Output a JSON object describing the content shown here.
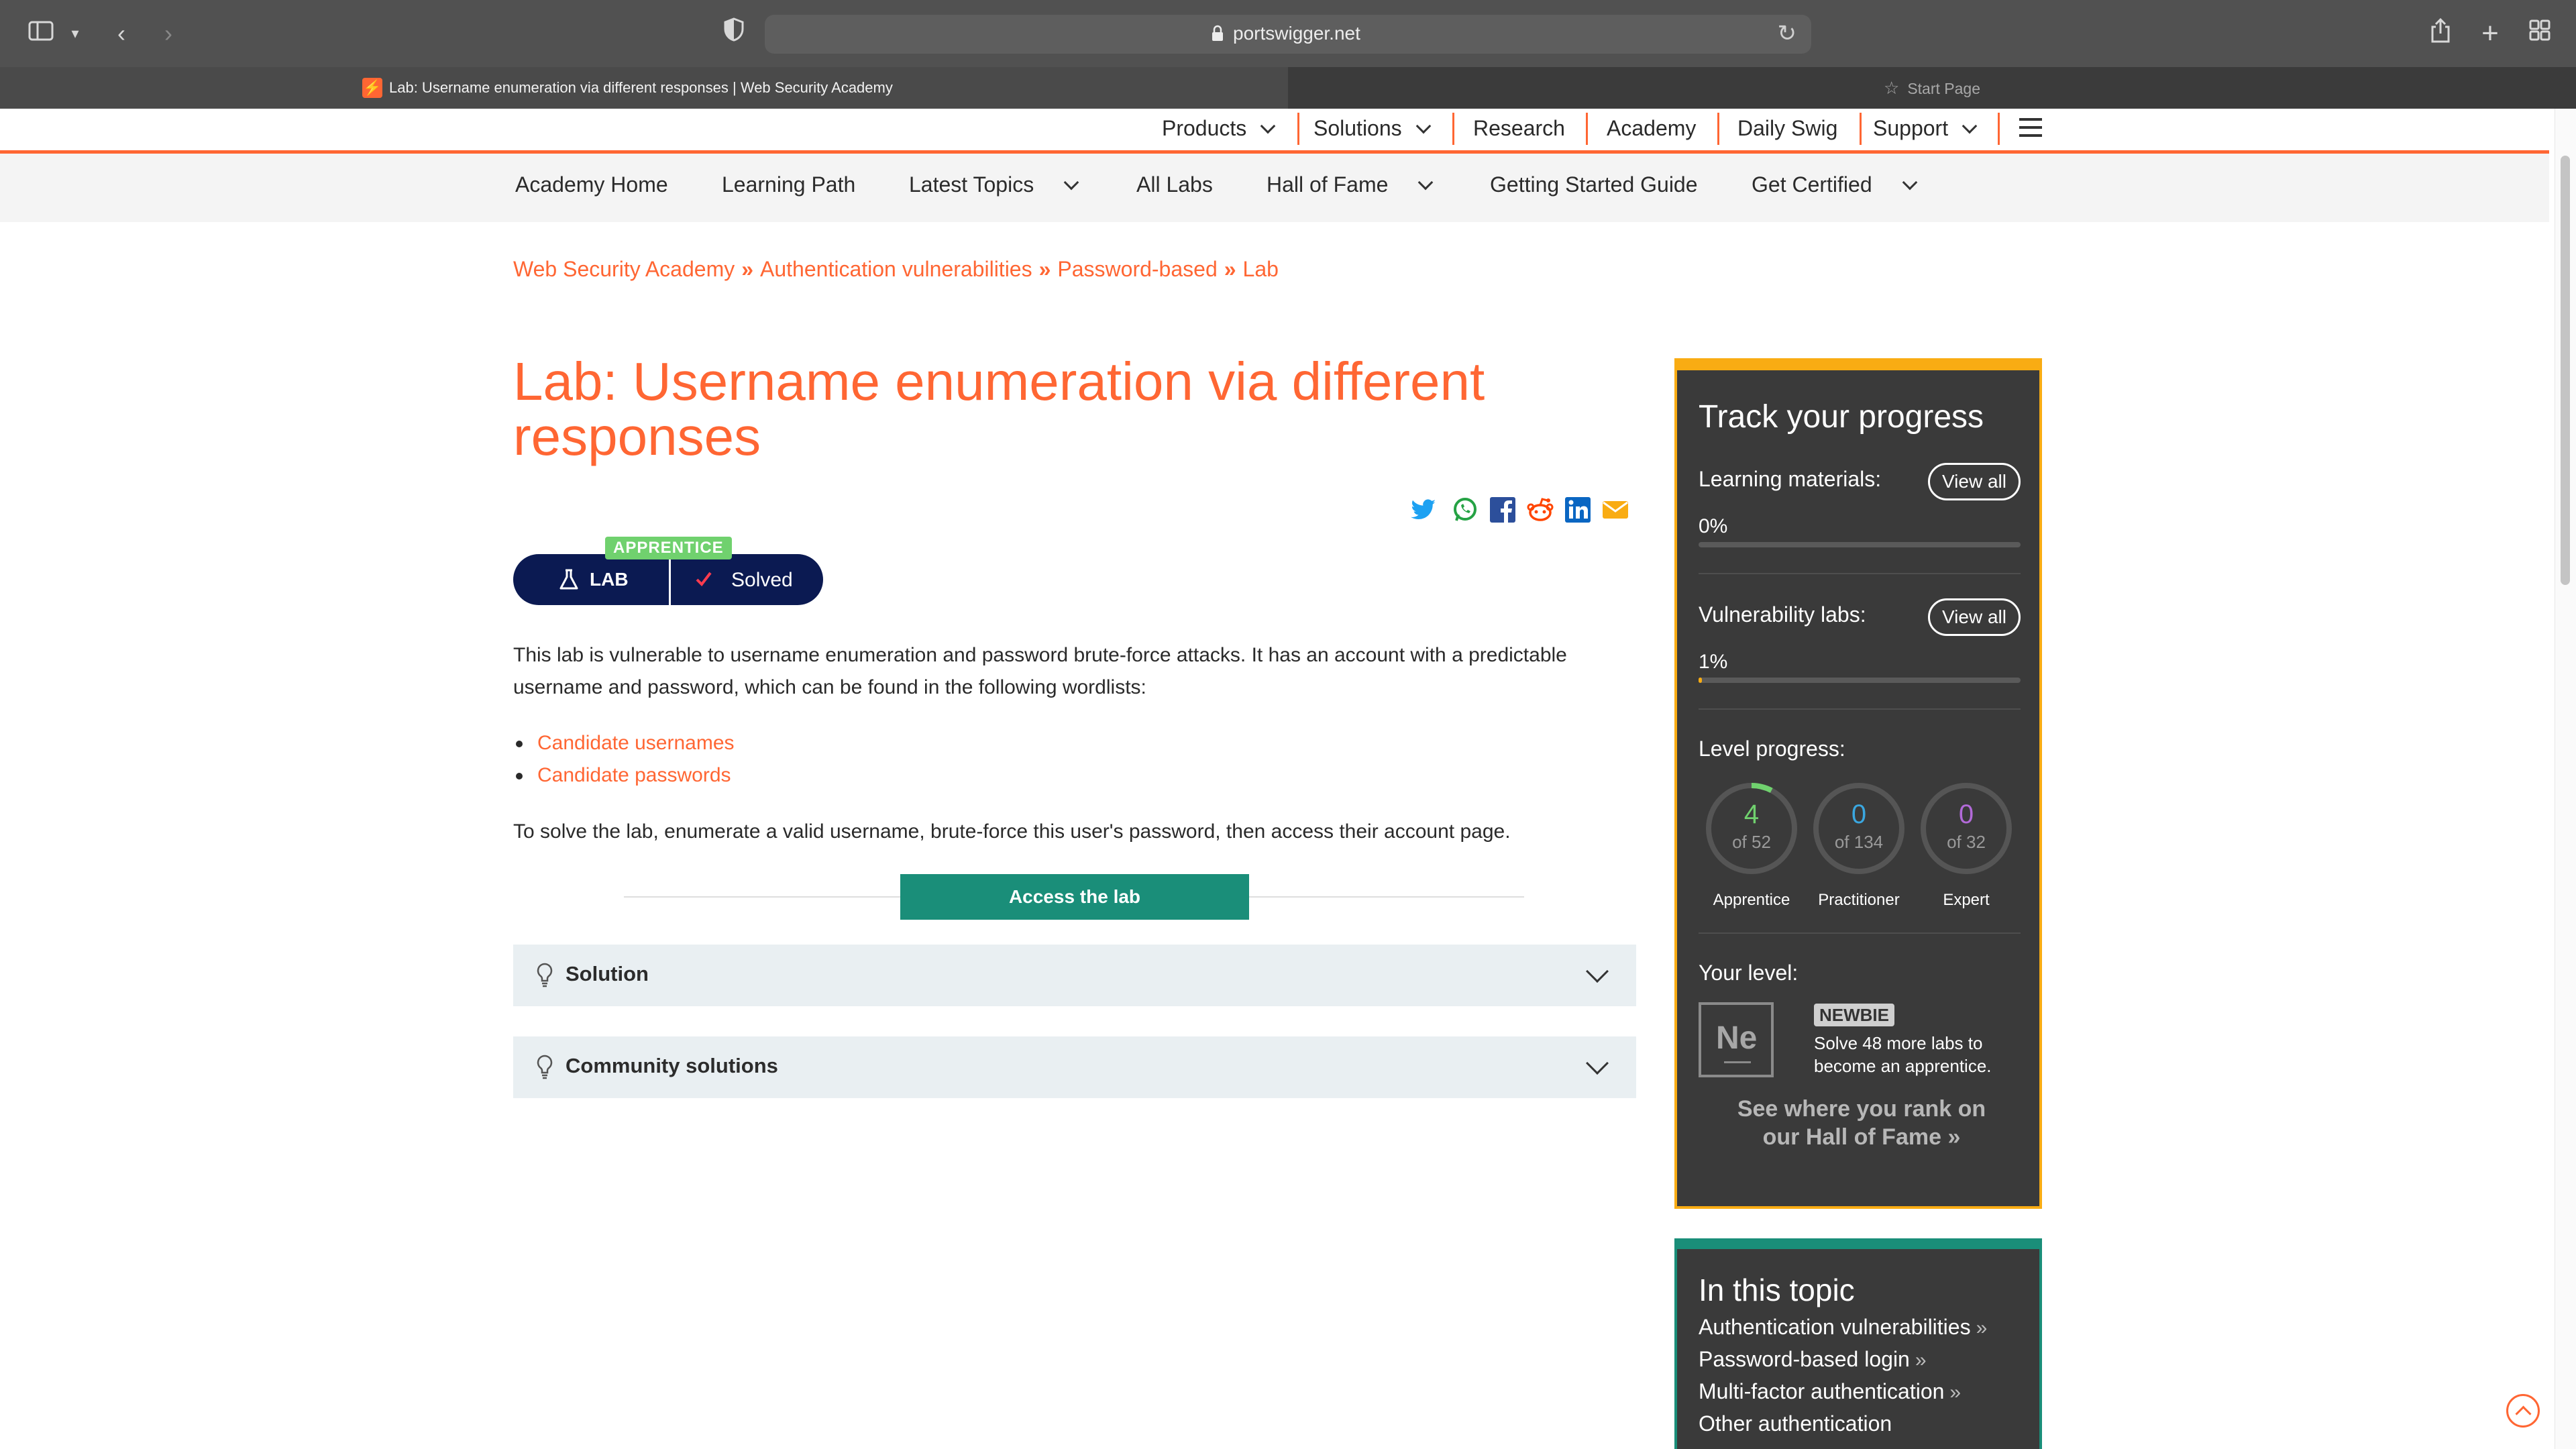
{
  "browser": {
    "url": "portswigger.net",
    "active_tab_title": "Lab: Username enumeration via different responses | Web Security Academy",
    "start_page_tab": "Start Page"
  },
  "topnav": {
    "items": [
      "Products",
      "Solutions",
      "Research",
      "Academy",
      "Daily Swig",
      "Support"
    ]
  },
  "academy_nav": {
    "items": [
      "Academy Home",
      "Learning Path",
      "Latest Topics",
      "All Labs",
      "Hall of Fame",
      "Getting Started Guide",
      "Get Certified"
    ]
  },
  "breadcrumb": [
    "Web Security Academy",
    "Authentication vulnerabilities",
    "Password-based",
    "Lab"
  ],
  "lab": {
    "title": "Lab: Username enumeration via different responses",
    "level_tag": "APPRENTICE",
    "badge_lab": "LAB",
    "badge_status": "Solved",
    "intro": "This lab is vulnerable to username enumeration and password brute-force attacks. It has an account with a predictable username and password, which can be found in the following wordlists:",
    "wordlists": [
      "Candidate usernames",
      "Candidate passwords"
    ],
    "goal": "To solve the lab, enumerate a valid username, brute-force this user's password, then access their account page.",
    "access_button": "Access the lab",
    "accordions": [
      "Solution",
      "Community solutions"
    ]
  },
  "share_icons": [
    "twitter-icon",
    "whatsapp-icon",
    "facebook-icon",
    "reddit-icon",
    "linkedin-icon",
    "email-icon"
  ],
  "progress": {
    "title": "Track your progress",
    "learning_label": "Learning materials:",
    "learning_pct": "0%",
    "learning_value": 0,
    "labs_label": "Vulnerability labs:",
    "labs_pct": "1%",
    "labs_value": 0.01,
    "view_all": "View all",
    "level_label": "Level progress:",
    "levels": [
      {
        "count": "4",
        "of": "of 52",
        "name": "Apprentice",
        "color": "#70d16e",
        "fraction": 0.077
      },
      {
        "count": "0",
        "of": "of 134",
        "name": "Practitioner",
        "color": "#3aa7e0",
        "fraction": 0
      },
      {
        "count": "0",
        "of": "of 32",
        "name": "Expert",
        "color": "#b26ad8",
        "fraction": 0
      }
    ],
    "your_level_label": "Your level:",
    "level_symbol": "Ne",
    "level_name": "NEWBIE",
    "level_desc": "Solve 48 more labs to become an apprentice.",
    "rank_link": "See where you rank on our Hall of Fame"
  },
  "topic": {
    "title": "In this topic",
    "items": [
      "Authentication vulnerabilities",
      "Password-based login",
      "Multi-factor authentication",
      "Other authentication"
    ]
  },
  "colors": {
    "accent": "#ff6633",
    "navy": "#0b1a52",
    "green": "#1a8e79",
    "gold": "#f9ac13"
  }
}
